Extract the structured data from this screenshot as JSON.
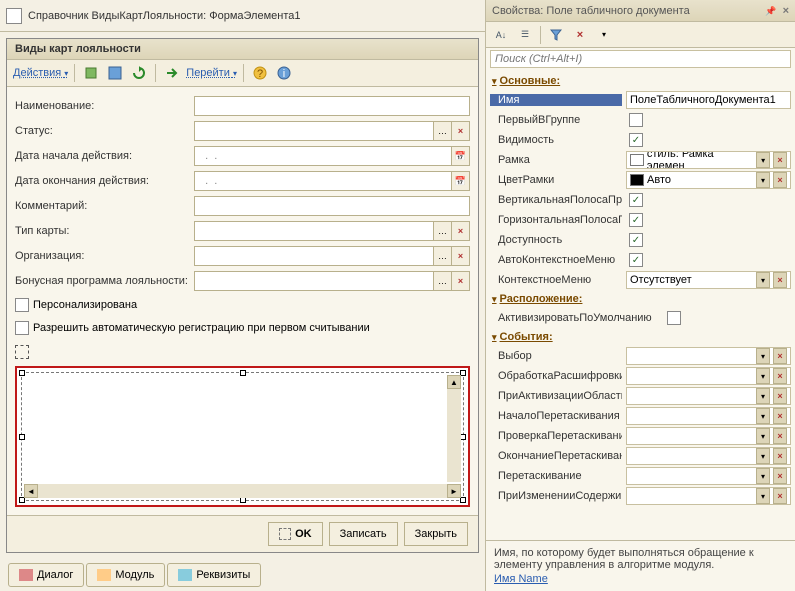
{
  "leftTitle": "Справочник ВидыКартЛояльности: ФормаЭлемента1",
  "formHeader": "Виды карт лояльности",
  "toolbar": {
    "actions": "Действия",
    "goto": "Перейти"
  },
  "fields": {
    "name": "Наименование:",
    "status": "Статус:",
    "startDate": "Дата начала действия:",
    "endDate": "Дата окончания действия:",
    "comment": "Комментарий:",
    "cardType": "Тип карты:",
    "org": "Организация:",
    "bonus": "Бонусная программа лояльности:",
    "personalized": "Персонализирована",
    "allowAuto": "Разрешить автоматическую регистрацию при первом считывании",
    "dateMask": "  .  .    "
  },
  "footer": {
    "ok": "OK",
    "write": "Записать",
    "close": "Закрыть"
  },
  "tabs": {
    "dialog": "Диалог",
    "module": "Модуль",
    "req": "Реквизиты"
  },
  "props": {
    "title": "Свойства: Поле табличного документа",
    "search": "Поиск (Ctrl+Alt+I)",
    "groups": {
      "main": "Основные:",
      "layout": "Расположение:",
      "events": "События:"
    },
    "main": {
      "name": {
        "label": "Имя",
        "value": "ПолеТабличногоДокумента1"
      },
      "firstInGroup": "ПервыйВГруппе",
      "visibility": "Видимость",
      "frame": {
        "label": "Рамка",
        "value": "стиль: Рамка элемен"
      },
      "frameColor": {
        "label": "ЦветРамки",
        "value": "Авто"
      },
      "vscroll": "ВертикальнаяПолосаПро",
      "hscroll": "ГоризонтальнаяПолосаП",
      "enabled": "Доступность",
      "autoCtx": "АвтоКонтекстноеМеню",
      "ctxMenu": {
        "label": "КонтекстноеМеню",
        "value": "Отсутствует"
      }
    },
    "layout": {
      "activate": "АктивизироватьПоУмолчанию"
    },
    "events": {
      "choice": "Выбор",
      "drill": "ОбработкаРасшифровки",
      "activate": "ПриАктивизацииОбласти",
      "dragStart": "НачалоПеретаскивания",
      "dragCheck": "ПроверкаПеретаскивани",
      "dragEnd": "ОкончаниеПеретаскиван",
      "drag": "Перетаскивание",
      "change": "ПриИзмененииСодержим"
    },
    "hint": "Имя, по которому будет выполняться обращение к элементу управления в алгоритме модуля.",
    "hintProp": "Имя  Name"
  }
}
